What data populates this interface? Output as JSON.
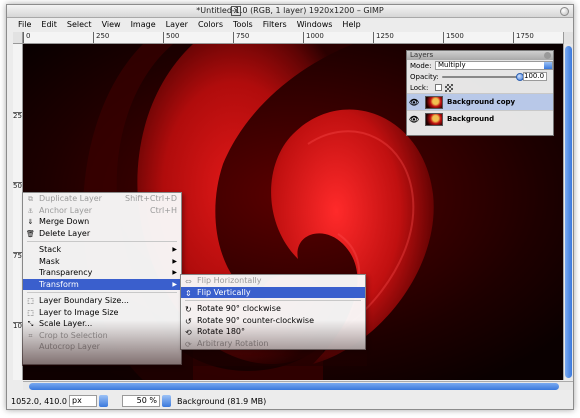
{
  "window": {
    "title": "*Untitled-1.0 (RGB, 1 layer) 1920x1200 – GIMP",
    "title_icon": "X"
  },
  "menubar": {
    "items": [
      "File",
      "Edit",
      "Select",
      "View",
      "Image",
      "Layer",
      "Colors",
      "Tools",
      "Filters",
      "Windows",
      "Help"
    ]
  },
  "ruler_top": {
    "labels": [
      "0",
      "250",
      "500",
      "750",
      "1000",
      "1250",
      "1500",
      "1750"
    ]
  },
  "ruler_left": {
    "labels": [
      "250",
      "500",
      "750",
      "1000"
    ]
  },
  "layers_panel": {
    "title": "Layers",
    "mode_label": "Mode:",
    "mode_value": "Multiply",
    "opacity_label": "Opacity:",
    "opacity_value": "100.0",
    "opacity_fraction": 1.0,
    "lock_label": "Lock:",
    "layers": [
      {
        "name": "Background copy",
        "selected": true
      },
      {
        "name": "Background",
        "selected": false
      }
    ]
  },
  "context_menu": {
    "items": [
      {
        "label": "Duplicate Layer",
        "accel": "Shift+Ctrl+D",
        "disabled": true,
        "icon": "duplicate-icon"
      },
      {
        "label": "Anchor Layer",
        "accel": "Ctrl+H",
        "disabled": true,
        "icon": "anchor-icon"
      },
      {
        "label": "Merge Down",
        "accel": "",
        "disabled": false,
        "icon": "merge-icon"
      },
      {
        "label": "Delete Layer",
        "accel": "",
        "disabled": false,
        "icon": "delete-icon"
      },
      {
        "label": "Stack",
        "submenu": true
      },
      {
        "label": "Mask",
        "submenu": true
      },
      {
        "label": "Transparency",
        "submenu": true
      },
      {
        "label": "Transform",
        "submenu": true,
        "highlighted": true
      },
      {
        "label": "Layer Boundary Size...",
        "icon": "boundary-icon"
      },
      {
        "label": "Layer to Image Size",
        "icon": "fit-icon"
      },
      {
        "label": "Scale Layer...",
        "icon": "scale-icon"
      },
      {
        "label": "Crop to Selection",
        "disabled": true,
        "icon": "crop-icon"
      },
      {
        "label": "Autocrop Layer",
        "disabled": true
      }
    ]
  },
  "transform_submenu": {
    "items": [
      {
        "label": "Flip Horizontally",
        "icon": "flip-horizontal-icon",
        "disabled": true
      },
      {
        "label": "Flip Vertically",
        "icon": "flip-vertical-icon",
        "highlighted": true
      },
      {
        "label": "Rotate 90° clockwise",
        "icon": "rotate-cw-icon"
      },
      {
        "label": "Rotate 90° counter-clockwise",
        "icon": "rotate-ccw-icon"
      },
      {
        "label": "Rotate 180°",
        "icon": "rotate-180-icon"
      },
      {
        "label": "Arbitrary Rotation",
        "icon": "rotate-arbitrary-icon",
        "disabled": true
      }
    ]
  },
  "statusbar": {
    "coords": "1052.0, 410.0",
    "unit": "px",
    "zoom": "50 %",
    "message": "Background (81.9 MB)"
  },
  "colors": {
    "accent": "#3a5fcd",
    "canvas_dark": "#1a0000",
    "canvas_red": "#c81010"
  }
}
